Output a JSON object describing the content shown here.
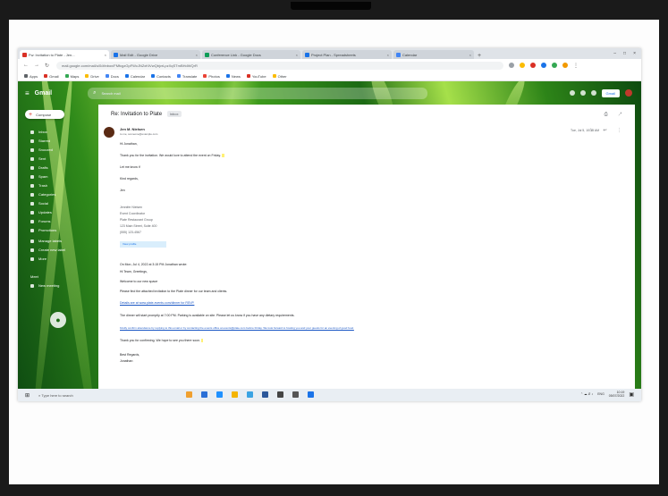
{
  "browser": {
    "tabs": [
      {
        "label": "Fw: Invitation to Plate - Jen...",
        "active": true,
        "color": "#d93025"
      },
      {
        "label": "Mail Edit - Google Drive",
        "active": false,
        "color": "#1a73e8"
      },
      {
        "label": "Conference Link - Google Docs",
        "active": false,
        "color": "#0f9d58"
      },
      {
        "label": "Project Plan - Spreadsheets",
        "active": false,
        "color": "#1a73e8"
      },
      {
        "label": "Calendar",
        "active": false,
        "color": "#4285f4"
      }
    ],
    "new_tab": "+",
    "window_controls": [
      "–",
      "□",
      "×"
    ],
    "url": "mail.google.com/mail/u/0/#inbox/FMfcgzGpFWcJNZxKtVwQbjvrLpzXqSTmBHdWQrR",
    "bookmarks": [
      "Apps",
      "Gmail",
      "Maps",
      "Drive",
      "Docs",
      "Calendar",
      "Contacts",
      "Translate",
      "Photos",
      "News",
      "YouTube",
      "Other"
    ]
  },
  "gmail": {
    "menu_icon": "≡",
    "logo": "Gmail",
    "search": {
      "icon": "⌕",
      "placeholder": "Search mail"
    },
    "toolbar_icons": "◂ ▣ ◷ ✉ ⋮",
    "account_badge": "Gmail",
    "compose": {
      "icon": "+",
      "label": "Compose"
    },
    "nav": [
      "Inbox",
      "Starred",
      "Snoozed",
      "Sent",
      "Drafts",
      "Spam",
      "Trash",
      "Categories",
      "Social",
      "Updates",
      "Forums",
      "Promotions",
      "Manage labels",
      "Create new label",
      "More",
      "Meet",
      "New meeting"
    ],
    "meet_icon": "●"
  },
  "message": {
    "subject": "Re: Invitation to Plate",
    "label": "Inbox",
    "tools": "⎙ ↗",
    "sender_name": "Jen M. Nielsen",
    "sender_email": "to me, someone@example.com",
    "date": "Tue, Jul 5, 10:18 AM",
    "reply_icons": "☆ ↩ ⋮",
    "body_lines": [
      "Hi Jonathan,",
      "Thank you for the invitation. We would love to attend the event on Friday.",
      "Let me know if",
      "Kind regards,",
      "Jen",
      "",
      "Jennifer Nielsen",
      "Event Coordinator",
      "Plate Restaurant Group",
      "123 Main Street, Suite 400",
      "(555) 123-4567"
    ],
    "sig_button": "View profile",
    "thread": [
      "On Mon, Jul 4, 2022 at 3:15 PM Jonathan wrote:",
      "Hi Team, Greetings,",
      "Welcome to our new space",
      "Please find the attached invitation to the Plate dinner for our team and clients.",
      "Details are at www.plate-events.com/dinner for RSVP.",
      "The dinner will start promptly at 7:00 PM. Parking is available on site. Please let us know if you have any dietary requirements.",
      "Kindly confirm attendance by replying to this email or by contacting the events office at events@plate.com before Friday. We look forward to hosting you and your guests for an evening of good food.",
      "Thank you for confirming. We hope to see you there soon.",
      "Best Regards,",
      "Jonathan"
    ]
  },
  "taskbar": {
    "start_icon": "⊞",
    "search_icon": "⌕",
    "search_placeholder": "Type here to search",
    "apps": [
      "#f0a030",
      "#2a6fd6",
      "#1e90ff",
      "#f4b400",
      "#3aa3e3",
      "#2b579a",
      "#444444",
      "#555555",
      "#1a73e8"
    ],
    "tray_icons": "⌃ ☁ ⇵ ♪",
    "tray_lang": "ENG",
    "time": "10:19",
    "date": "05/07/2022"
  }
}
